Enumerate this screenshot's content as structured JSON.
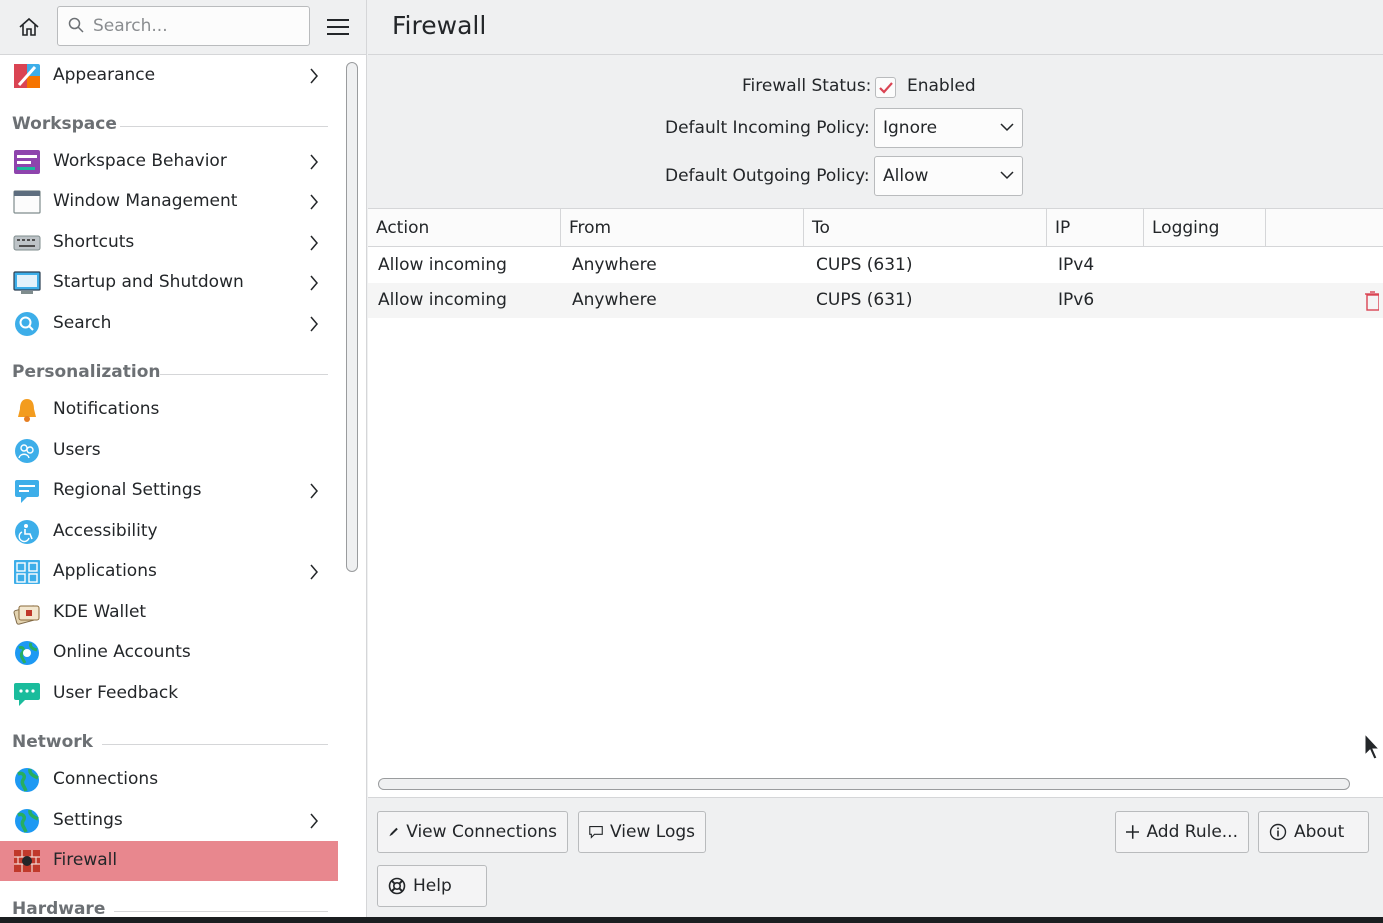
{
  "sidebar": {
    "search_placeholder": "Search...",
    "items": {
      "appearance": "Appearance",
      "workspace_behavior": "Workspace Behavior",
      "window_management": "Window Management",
      "shortcuts": "Shortcuts",
      "startup_shutdown": "Startup and Shutdown",
      "search": "Search",
      "notifications": "Notifications",
      "users": "Users",
      "regional_settings": "Regional Settings",
      "accessibility": "Accessibility",
      "applications": "Applications",
      "kde_wallet": "KDE Wallet",
      "online_accounts": "Online Accounts",
      "user_feedback": "User Feedback",
      "connections": "Connections",
      "settings": "Settings",
      "firewall": "Firewall"
    },
    "categories": {
      "workspace": "Workspace",
      "personalization": "Personalization",
      "network": "Network",
      "hardware": "Hardware"
    }
  },
  "main": {
    "title": "Firewall",
    "firewall_status_label": "Firewall Status:",
    "firewall_status_value": "Enabled",
    "incoming_label": "Default Incoming Policy:",
    "incoming_value": "Ignore",
    "outgoing_label": "Default Outgoing Policy:",
    "outgoing_value": "Allow"
  },
  "table": {
    "columns": {
      "action": "Action",
      "from": "From",
      "to": "To",
      "ip": "IP",
      "logging": "Logging"
    },
    "rows": [
      {
        "action": "Allow incoming",
        "from": "Anywhere",
        "to": "CUPS (631)",
        "ip": "IPv4",
        "logging": ""
      },
      {
        "action": "Allow incoming",
        "from": "Anywhere",
        "to": "CUPS (631)",
        "ip": "IPv6",
        "logging": ""
      }
    ]
  },
  "buttons": {
    "view_connections": "View Connections",
    "view_logs": "View Logs",
    "add_rule": "Add Rule...",
    "about": "About",
    "help": "Help"
  },
  "colors": {
    "accent_selection": "#e8878e",
    "check_mark": "#da4453"
  }
}
